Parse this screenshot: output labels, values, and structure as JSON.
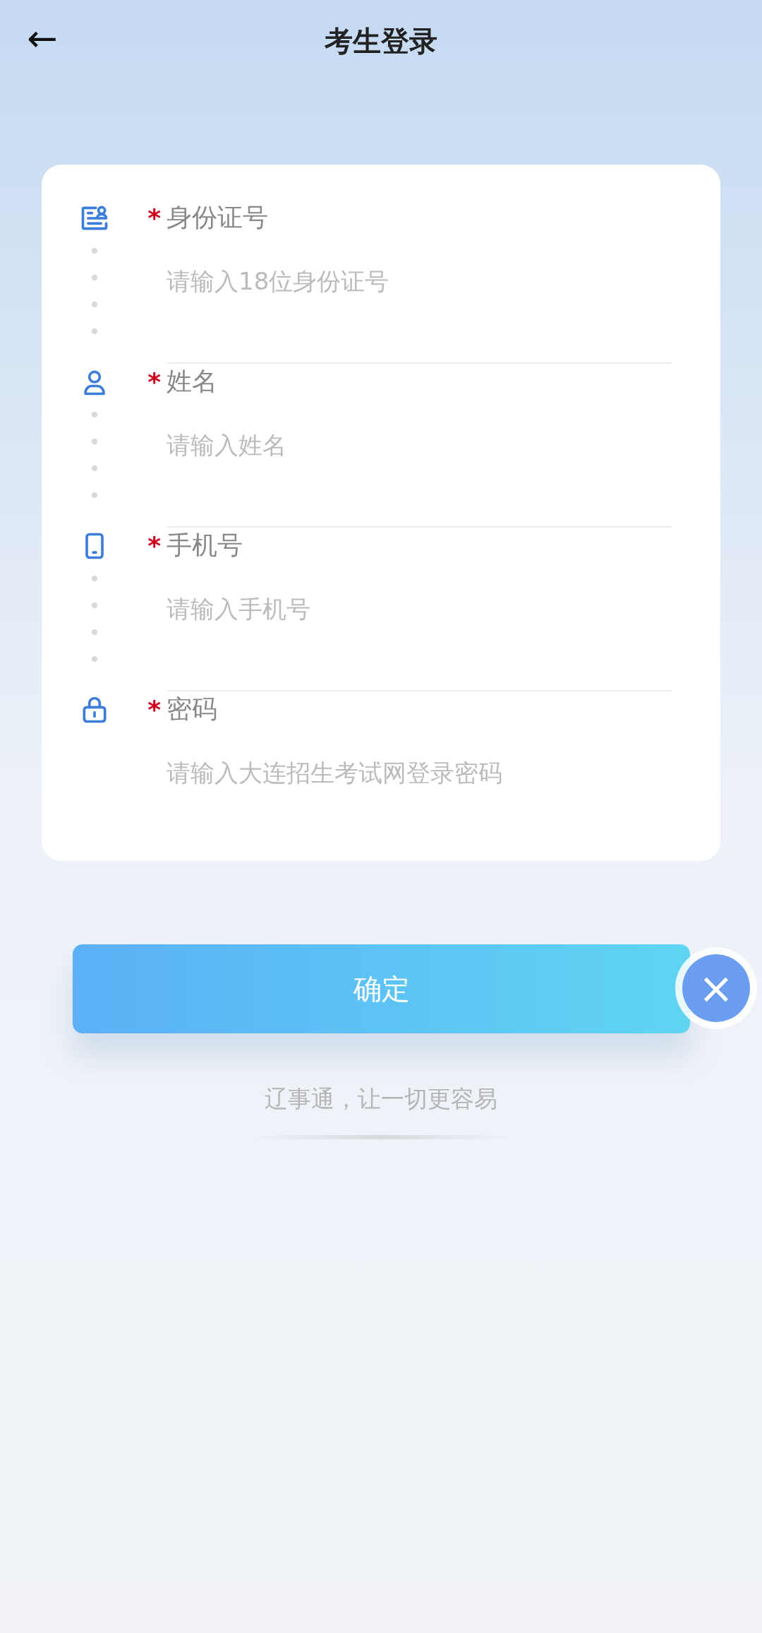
{
  "header": {
    "back": "←",
    "title": "考生登录"
  },
  "fields": [
    {
      "kind": "id-card",
      "required": true,
      "label": "身份证号",
      "placeholder": "请输入18位身份证号"
    },
    {
      "kind": "person",
      "required": true,
      "label": "姓名",
      "placeholder": "请输入姓名"
    },
    {
      "kind": "phone",
      "required": true,
      "label": "手机号",
      "placeholder": "请输入手机号"
    },
    {
      "kind": "lock",
      "required": true,
      "label": "密码",
      "placeholder": "请输入大连招生考试网登录密码"
    }
  ],
  "required_mark": "*",
  "submit": "确定",
  "close": "×",
  "slogan": "辽事通，让一切更容易"
}
